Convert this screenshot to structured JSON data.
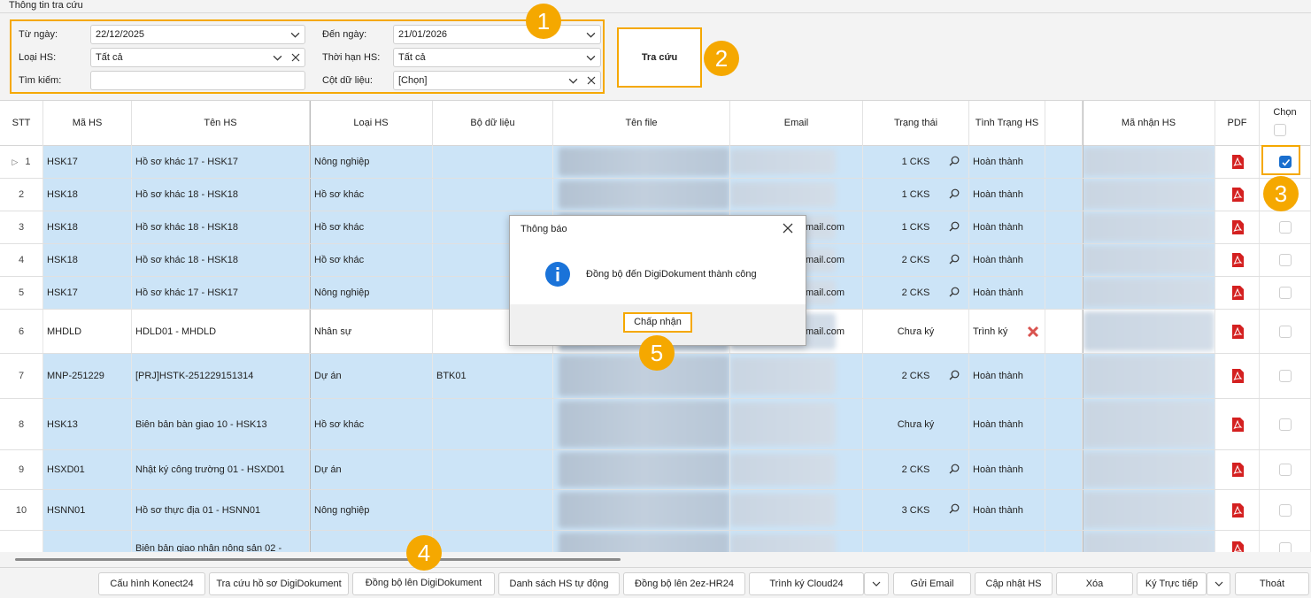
{
  "group_title": "Thông tin tra cứu",
  "filters": {
    "from_label": "Từ ngày:",
    "from_value": "22/12/2025",
    "to_label": "Đến ngày:",
    "to_value": "21/01/2026",
    "type_label": "Loại HS:",
    "type_value": "Tất cả",
    "term_label": "Thời hạn HS:",
    "term_value": "Tất cả",
    "search_label": "Tìm kiếm:",
    "search_value": "",
    "cols_label": "Cột dữ liệu:",
    "cols_value": "[Chọn]"
  },
  "search_button": "Tra cứu",
  "badges": [
    "1",
    "2",
    "3",
    "4",
    "5"
  ],
  "columns": [
    "STT",
    "Mã HS",
    "Tên HS",
    "Loại HS",
    "Bộ dữ liệu",
    "Tên file",
    "Email",
    "Trạng thái",
    "Tình Trạng HS",
    "Mã nhận HS",
    "PDF",
    "Chọn"
  ],
  "rows": [
    {
      "stt": "1",
      "ma": "HSK17",
      "ten": "Hồ sơ khác 17 - HSK17",
      "loai": "Nông nghiệp",
      "bo": "",
      "email": "",
      "tt": "1 CKS",
      "tinh": "Hoàn thành",
      "checked": true
    },
    {
      "stt": "2",
      "ma": "HSK18",
      "ten": "Hồ sơ khác 18 - HSK18",
      "loai": "Hồ sơ khác",
      "bo": "",
      "email": "",
      "tt": "1 CKS",
      "tinh": "Hoàn thành"
    },
    {
      "stt": "3",
      "ma": "HSK18",
      "ten": "Hồ sơ khác 18 - HSK18",
      "loai": "Hồ sơ khác",
      "bo": "",
      "email": "mail.com",
      "tt": "1 CKS",
      "tinh": "Hoàn thành"
    },
    {
      "stt": "4",
      "ma": "HSK18",
      "ten": "Hồ sơ khác 18 - HSK18",
      "loai": "Hồ sơ khác",
      "bo": "",
      "email": "mail.com",
      "tt": "2 CKS",
      "tinh": "Hoàn thành"
    },
    {
      "stt": "5",
      "ma": "HSK17",
      "ten": "Hồ sơ khác 17 - HSK17",
      "loai": "Nông nghiệp",
      "bo": "",
      "email": "mail.com",
      "tt": "2 CKS",
      "tinh": "Hoàn thành"
    },
    {
      "stt": "6",
      "ma": "MHDLD",
      "ten": "HDLD01 - MHDLD",
      "loai": "Nhân sự",
      "bo": "",
      "email": "mail.com",
      "tt": "Chưa ký",
      "tinh": "Trình ký"
    },
    {
      "stt": "7",
      "ma": "MNP-251229",
      "ten": "[PRJ]HSTK-251229151314",
      "loai": "Dự án",
      "bo": "BTK01",
      "email": "",
      "tt": "2 CKS",
      "tinh": "Hoàn thành"
    },
    {
      "stt": "8",
      "ma": "HSK13",
      "ten": "Biên bản bàn giao 10 - HSK13",
      "loai": "Hồ sơ khác",
      "bo": "",
      "email": "",
      "tt": "Chưa ký",
      "tinh": "Hoàn thành"
    },
    {
      "stt": "9",
      "ma": "HSXD01",
      "ten": "Nhật ký công trường 01 - HSXD01",
      "loai": "Dự án",
      "bo": "",
      "email": "",
      "tt": "2 CKS",
      "tinh": "Hoàn thành"
    },
    {
      "stt": "10",
      "ma": "HSNN01",
      "ten": "Hồ sơ thực địa 01 - HSNN01",
      "loai": "Nông nghiệp",
      "bo": "",
      "email": "",
      "tt": "3 CKS",
      "tinh": "Hoàn thành"
    },
    {
      "stt": "",
      "ma": "",
      "ten": "Biên bản giao nhận nông sản 02 -",
      "loai": "",
      "bo": "",
      "email": "",
      "tt": "",
      "tinh": ""
    }
  ],
  "dialog": {
    "title": "Thông báo",
    "message": "Đồng bộ đến DigiDokument thành công",
    "ok": "Chấp nhận"
  },
  "buttons": [
    "Cấu hình Konect24",
    "Tra cứu hồ sơ DigiDokument",
    "Đồng bộ lên DigiDokument",
    "Danh sách HS tự động",
    "Đồng bộ lên 2ez-HR24",
    "Trình ký Cloud24",
    "Gửi Email",
    "Cập nhật HS",
    "Xóa",
    "Ký Trực tiếp",
    "Thoát"
  ],
  "colors": {
    "accent": "#f5a800",
    "row_selected": "#cce4f7",
    "info_icon": "#1a73d9",
    "pdf_red": "#d42020"
  }
}
